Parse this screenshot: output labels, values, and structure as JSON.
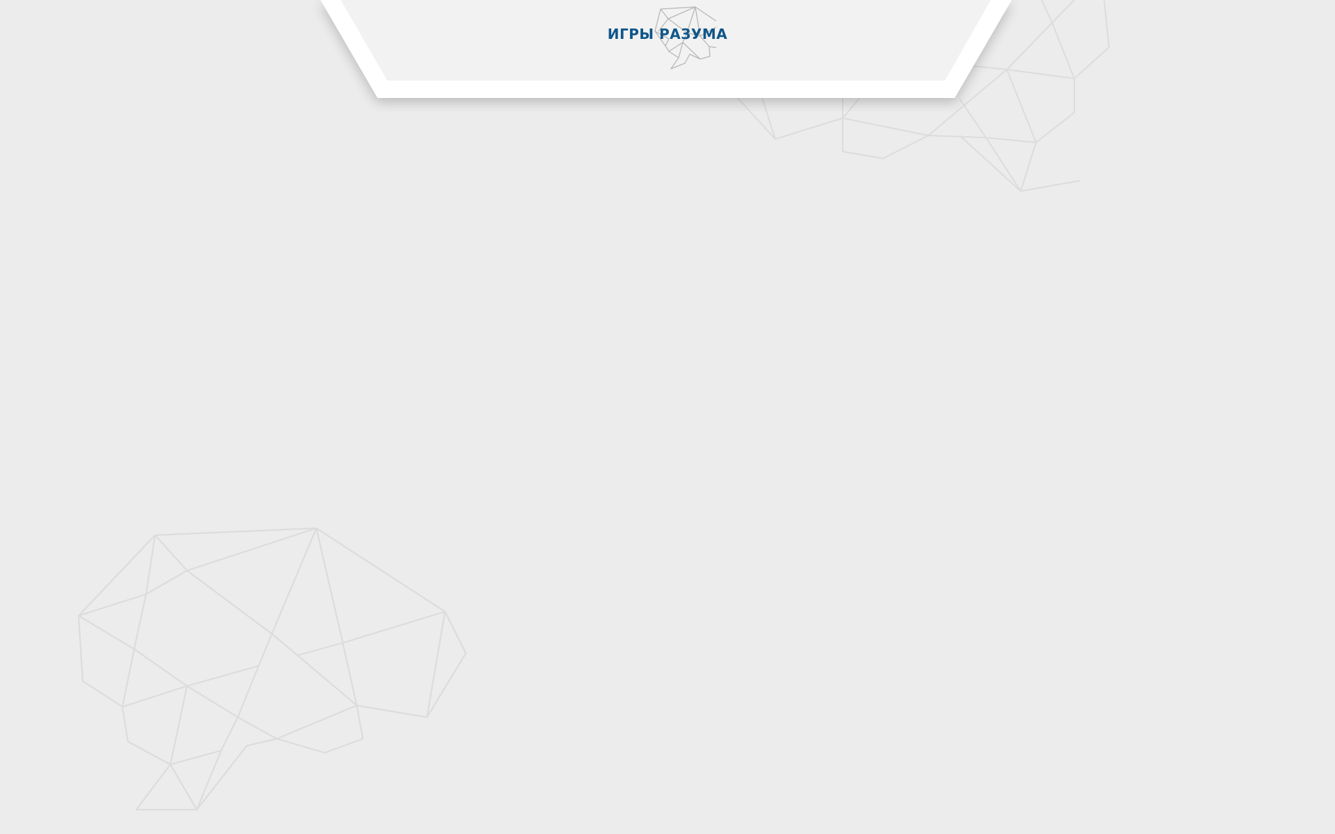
{
  "header": {
    "logo_text": "ИГРЫ РАЗУМА",
    "logo_icon": "brain-wireframe-icon"
  },
  "colors": {
    "background": "#ececec",
    "header_fill": "#f2f2f2",
    "header_border": "#ffffff",
    "logo_text": "#0f5689",
    "wireframe_lines": "#dcdcdc",
    "logo_icon_lines": "#b7b7b7"
  },
  "decorations": [
    "brain-wireframe-top-right",
    "brain-wireframe-bottom-left"
  ]
}
